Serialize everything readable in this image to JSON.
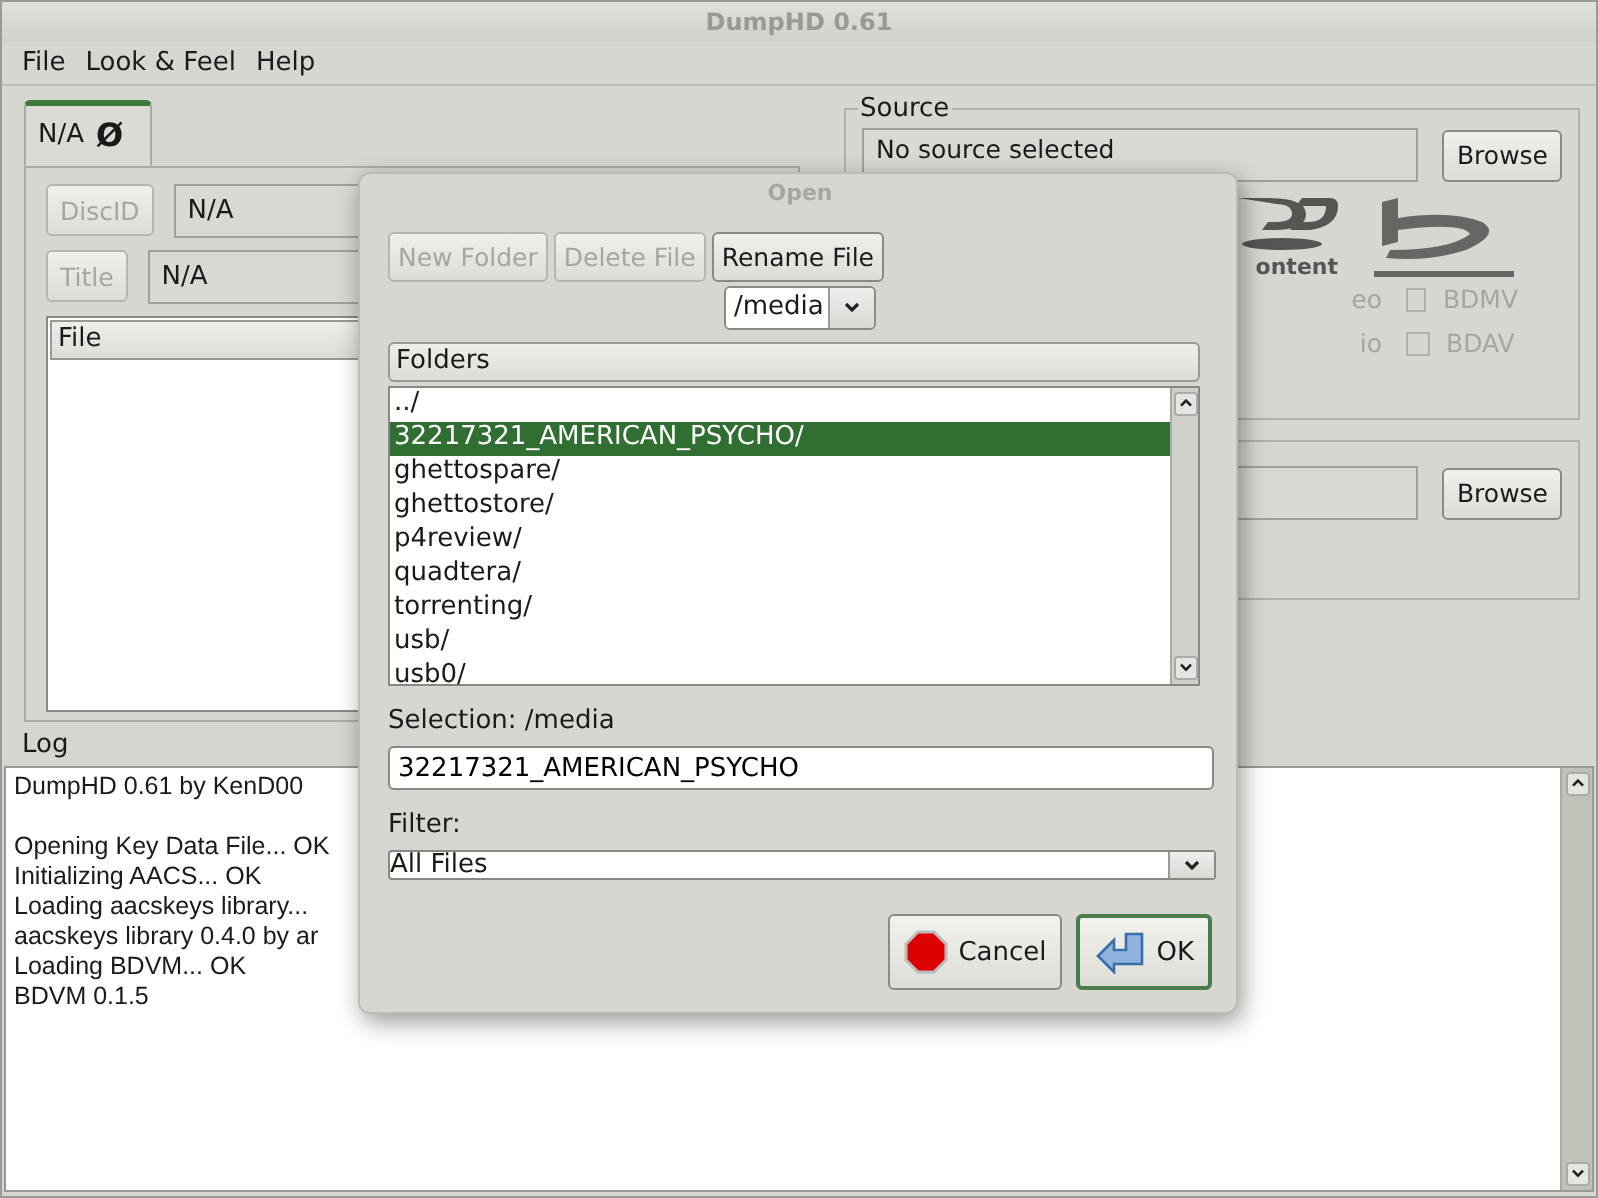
{
  "window": {
    "title": "DumpHD 0.61"
  },
  "menu": [
    {
      "label": "File"
    },
    {
      "label": "Look & Feel"
    },
    {
      "label": "Help"
    }
  ],
  "disc_tab": {
    "label": "N/A",
    "symbol": "Ø",
    "selected": true
  },
  "disc_fields": [
    {
      "button": "DiscID",
      "value": "N/A",
      "disabled": true
    },
    {
      "button": "Title",
      "value": "N/A",
      "disabled": true
    }
  ],
  "file_table": {
    "columns": [
      "File"
    ]
  },
  "source": {
    "title": "Source",
    "value": "No source selected",
    "button": "Browse",
    "logo_caption": "ontent",
    "hidden_labels": [
      "eo",
      "io"
    ],
    "options": [
      {
        "label": "BDMV",
        "checked": false,
        "disabled": true
      },
      {
        "label": "BDAV",
        "checked": false,
        "disabled": true
      }
    ]
  },
  "destination": {
    "button": "Browse"
  },
  "log": {
    "title": "Log",
    "blocks": [
      [
        "DumpHD 0.61 by KenD00"
      ],
      [
        "Opening Key Data File... OK",
        "Initializing AACS... OK",
        "Loading aacskeys library...",
        "aacskeys library 0.4.0 by ar",
        "Loading BDVM... OK",
        "BDVM 0.1.5"
      ]
    ]
  },
  "dialog": {
    "title": "Open",
    "buttons": [
      {
        "label": "New Folder",
        "disabled": true
      },
      {
        "label": "Delete File",
        "disabled": true
      },
      {
        "label": "Rename File",
        "disabled": false
      }
    ],
    "path": "/media",
    "list_header": "Folders",
    "folders": [
      {
        "name": "../",
        "selected": false
      },
      {
        "name": "32217321_AMERICAN_PSYCHO/",
        "selected": true
      },
      {
        "name": "ghettospare/",
        "selected": false
      },
      {
        "name": "ghettostore/",
        "selected": false
      },
      {
        "name": "p4review/",
        "selected": false
      },
      {
        "name": "quadtera/",
        "selected": false
      },
      {
        "name": "torrenting/",
        "selected": false
      },
      {
        "name": "usb/",
        "selected": false
      },
      {
        "name": "usb0/",
        "selected": false
      }
    ],
    "selection_label": "Selection: /media",
    "selection_value": "32217321_AMERICAN_PSYCHO",
    "filter_label": "Filter:",
    "filter_value": "All Files",
    "actions": [
      {
        "label": "Cancel",
        "kind": "cancel",
        "default": false
      },
      {
        "label": "OK",
        "kind": "ok",
        "default": true
      }
    ]
  }
}
